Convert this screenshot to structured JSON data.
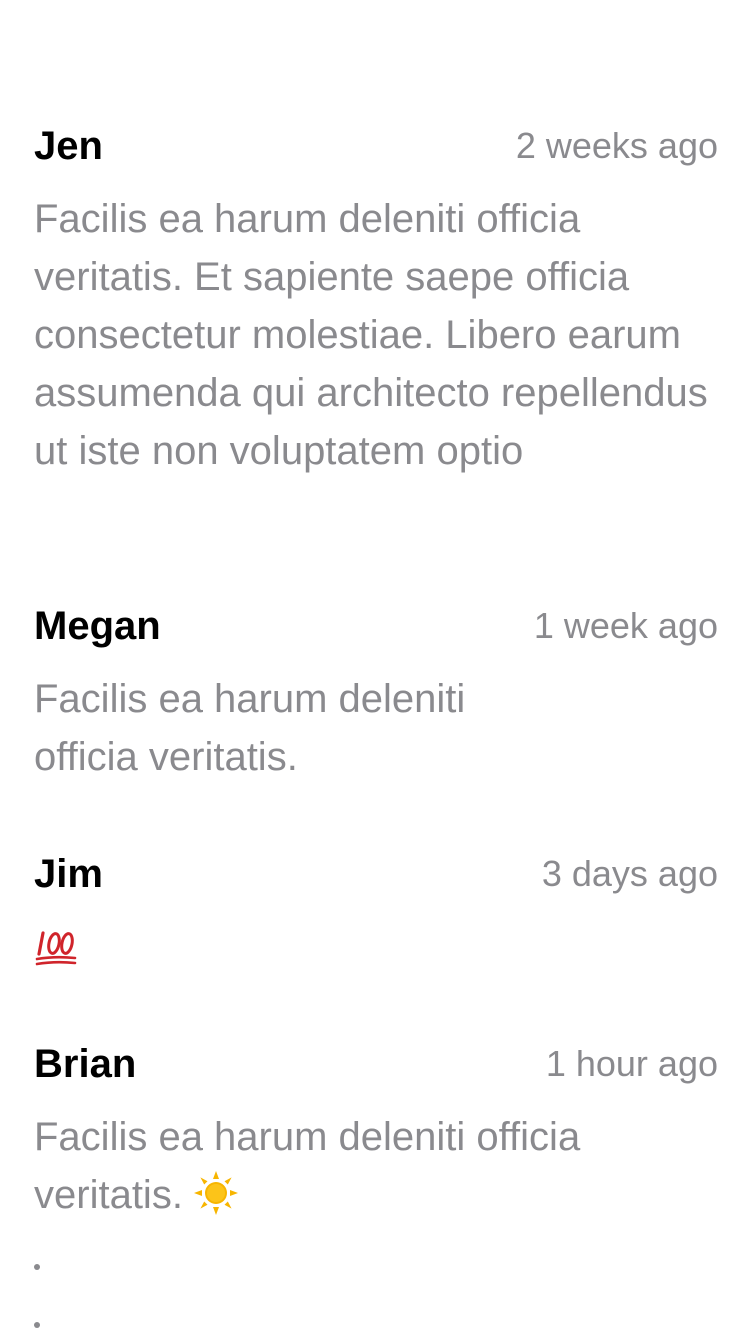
{
  "comments": [
    {
      "author": "Jen",
      "time": "2 weeks ago",
      "text": "Facilis ea harum deleniti officia veritatis. Et sapiente saepe officia consectetur molestiae. Libero earum assumenda qui architecto repellendus ut iste non voluptatem optio"
    },
    {
      "author": "Megan",
      "time": "1 week ago",
      "text": "Facilis ea harum deleniti officia veritatis."
    },
    {
      "author": "Jim",
      "time": "3 days ago",
      "icon": "hundred-points-emoji"
    },
    {
      "author": "Brian",
      "time": "1 hour ago",
      "text": "Facilis ea harum deleniti officia veritatis.",
      "icon": "sun-emoji"
    }
  ],
  "colors": {
    "author": "#000000",
    "secondary_text": "#8a8a8e",
    "background": "#ffffff",
    "emoji_red": "#d0242b",
    "sun_yellow": "#f7b500"
  }
}
